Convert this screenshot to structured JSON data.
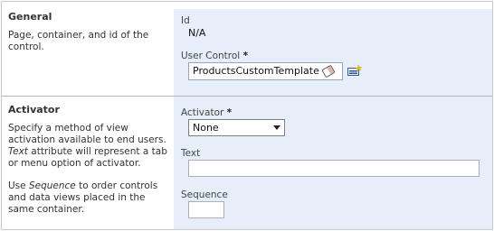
{
  "general": {
    "title": "General",
    "description": "Page, container, and id of the control.",
    "id_label": "Id",
    "id_value": "N/A",
    "user_control_label": "User Control",
    "required_mark": "*",
    "user_control_value": "ProductsCustomTemplate"
  },
  "activator": {
    "title": "Activator",
    "desc1_a": "Specify a method of view activation available to end users.",
    "desc1_em": "Text",
    "desc1_b": "attribute will represent a tab or menu option of activator.",
    "desc2_a": "Use",
    "desc2_em": "Sequence",
    "desc2_b": "to order controls and data views placed in the same container.",
    "activator_label": "Activator",
    "required_mark": "*",
    "activator_value": "None",
    "text_label": "Text",
    "text_value": "",
    "sequence_label": "Sequence",
    "sequence_value": ""
  },
  "colors": {
    "panel_bg": "#e6eef9",
    "divider": "#b5b5b5"
  },
  "icons": [
    "eraser-icon",
    "new-item-icon",
    "dropdown-arrow-icon"
  ]
}
